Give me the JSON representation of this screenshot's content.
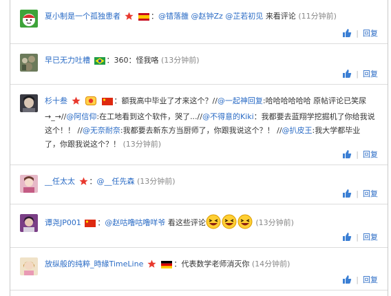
{
  "colors": {
    "link": "#2a6bc5",
    "text": "#333333",
    "muted": "#888888",
    "divider": "#dcdcdc"
  },
  "actions": {
    "like_icon": "thumbs-up-icon",
    "separator": "|",
    "reply_label": "回复"
  },
  "comments": [
    {
      "username": "夏小制是一个孤独患者",
      "badges": [
        "red-star-badge",
        "spain-flag"
      ],
      "colon": "：",
      "mentions": [
        "@错落雒",
        "@赵钟Zz",
        "@芷若初见"
      ],
      "text": "来看评论",
      "time": "(11分钟前)"
    },
    {
      "username": "早已无力吐槽",
      "badges": [
        "brazil-flag"
      ],
      "colon": "：",
      "text": "360：怪我咯",
      "time": "(13分钟前)"
    },
    {
      "username": "杉十叁",
      "badges": [
        "red-star-badge",
        "vip-badge",
        "china-flag"
      ],
      "colon": "：",
      "segments": [
        {
          "t": "text",
          "v": "额我高中毕业了才来这个？//"
        },
        {
          "t": "mention",
          "v": "@一起神回复"
        },
        {
          "t": "text",
          "v": ":哈哈哈哈哈哈 原帖评论已笑尿→_→//"
        },
        {
          "t": "mention",
          "v": "@阿信仰"
        },
        {
          "t": "text",
          "v": ":在工地看到这个软件，哭了...//"
        },
        {
          "t": "mention",
          "v": "@不得意的Kiki"
        },
        {
          "t": "text",
          "v": "：我都要去蓝翔学挖掘机了你给我说这个！！ //"
        },
        {
          "t": "mention",
          "v": "@无奈耐奈"
        },
        {
          "t": "text",
          "v": ":我都要去新东方当厨师了，你跟我说这个？！ //"
        },
        {
          "t": "mention",
          "v": "@扒皮王"
        },
        {
          "t": "text",
          "v": ":我大学都毕业了，你跟我说这个？！"
        }
      ],
      "time": "(13分钟前)"
    },
    {
      "username": "__任太太",
      "badges": [
        "red-star-badge"
      ],
      "colon": "：",
      "mentions": [
        "@__任先森"
      ],
      "text": "",
      "time": "(13分钟前)"
    },
    {
      "username": "谭尧JP001",
      "badges": [
        "china-flag"
      ],
      "colon": "：",
      "mentions": [
        "@赵咕噜咕噜咩爷"
      ],
      "text": "看这些评论",
      "emojis": [
        "laughing-face-icon",
        "laughing-face-icon",
        "laughing-face-icon"
      ],
      "time": "(13分钟前)"
    },
    {
      "username": "放纵般的纯粹_時緣TimeLine",
      "badges": [
        "red-star-badge",
        "germany-flag"
      ],
      "colon": "：",
      "text": "代表数学老师消灭你",
      "time": "(14分钟前)"
    }
  ]
}
